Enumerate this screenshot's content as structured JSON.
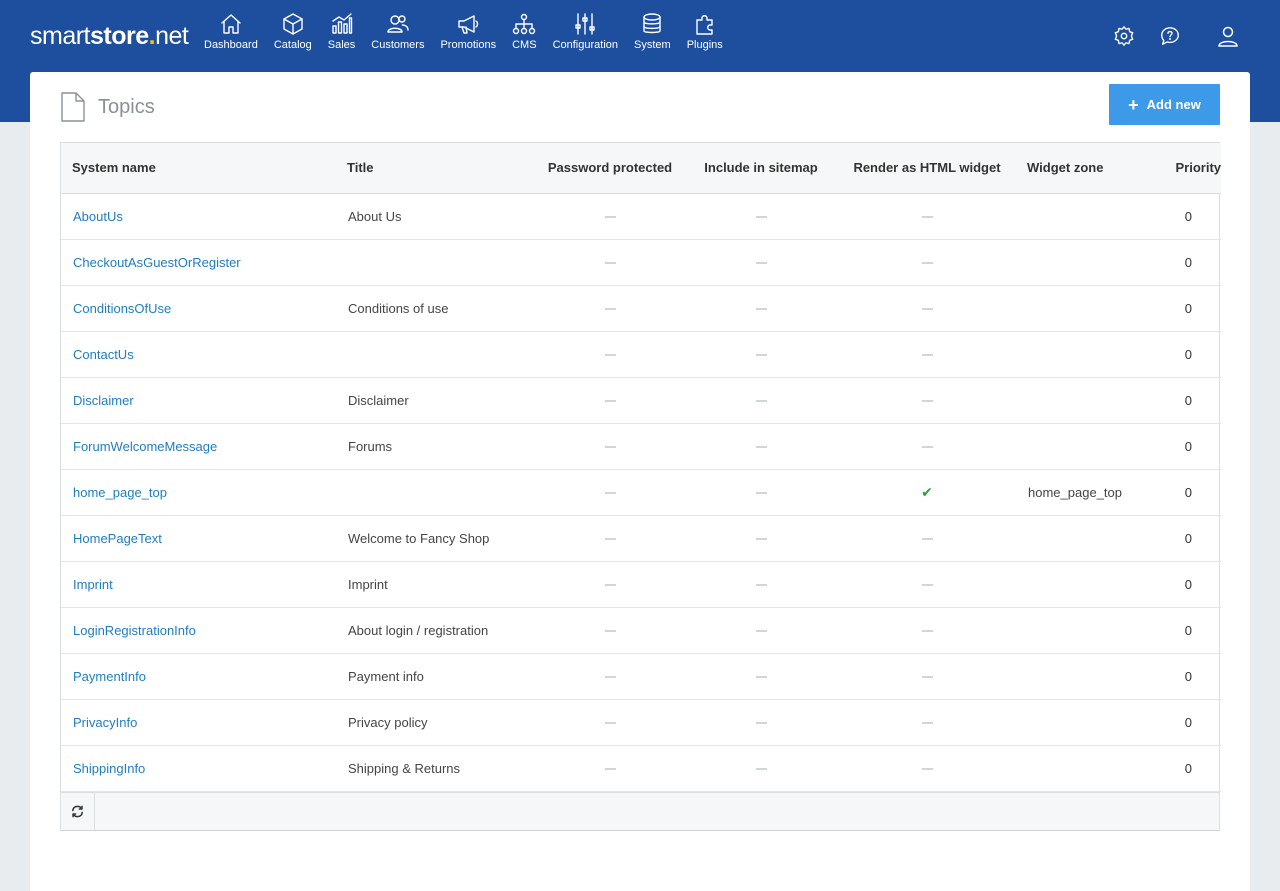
{
  "brand": {
    "part1": "smart",
    "part2": "store",
    "dot": ".",
    "part3": "net"
  },
  "nav": [
    {
      "label": "Dashboard",
      "icon": "house-icon"
    },
    {
      "label": "Catalog",
      "icon": "cube-icon"
    },
    {
      "label": "Sales",
      "icon": "bar-chart-icon"
    },
    {
      "label": "Customers",
      "icon": "users-icon"
    },
    {
      "label": "Promotions",
      "icon": "megaphone-icon"
    },
    {
      "label": "CMS",
      "icon": "sitemap-icon"
    },
    {
      "label": "Configuration",
      "icon": "sliders-icon"
    },
    {
      "label": "System",
      "icon": "database-icon"
    },
    {
      "label": "Plugins",
      "icon": "puzzle-icon"
    }
  ],
  "header_actions": {
    "settings": "gear-icon",
    "help": "help-chat-icon",
    "user": "user-icon"
  },
  "page": {
    "title": "Topics",
    "add_button": "Add new"
  },
  "grid": {
    "columns": [
      "System name",
      "Title",
      "Password protected",
      "Include in sitemap",
      "Render as HTML widget",
      "Widget zone",
      "Priority"
    ],
    "rows": [
      {
        "system_name": "AboutUs",
        "title": "About Us",
        "password_protected": false,
        "include_in_sitemap": false,
        "render_as_widget": false,
        "widget_zone": "",
        "priority": "0"
      },
      {
        "system_name": "CheckoutAsGuestOrRegister",
        "title": "",
        "password_protected": false,
        "include_in_sitemap": false,
        "render_as_widget": false,
        "widget_zone": "",
        "priority": "0"
      },
      {
        "system_name": "ConditionsOfUse",
        "title": "Conditions of use",
        "password_protected": false,
        "include_in_sitemap": false,
        "render_as_widget": false,
        "widget_zone": "",
        "priority": "0"
      },
      {
        "system_name": "ContactUs",
        "title": "",
        "password_protected": false,
        "include_in_sitemap": false,
        "render_as_widget": false,
        "widget_zone": "",
        "priority": "0"
      },
      {
        "system_name": "Disclaimer",
        "title": "Disclaimer",
        "password_protected": false,
        "include_in_sitemap": false,
        "render_as_widget": false,
        "widget_zone": "",
        "priority": "0"
      },
      {
        "system_name": "ForumWelcomeMessage",
        "title": "Forums",
        "password_protected": false,
        "include_in_sitemap": false,
        "render_as_widget": false,
        "widget_zone": "",
        "priority": "0"
      },
      {
        "system_name": "home_page_top",
        "title": "",
        "password_protected": false,
        "include_in_sitemap": false,
        "render_as_widget": true,
        "widget_zone": "home_page_top",
        "priority": "0"
      },
      {
        "system_name": "HomePageText",
        "title": "Welcome to Fancy Shop",
        "password_protected": false,
        "include_in_sitemap": false,
        "render_as_widget": false,
        "widget_zone": "",
        "priority": "0"
      },
      {
        "system_name": "Imprint",
        "title": "Imprint",
        "password_protected": false,
        "include_in_sitemap": false,
        "render_as_widget": false,
        "widget_zone": "",
        "priority": "0"
      },
      {
        "system_name": "LoginRegistrationInfo",
        "title": "About login / registration",
        "password_protected": false,
        "include_in_sitemap": false,
        "render_as_widget": false,
        "widget_zone": "",
        "priority": "0"
      },
      {
        "system_name": "PaymentInfo",
        "title": "Payment info",
        "password_protected": false,
        "include_in_sitemap": false,
        "render_as_widget": false,
        "widget_zone": "",
        "priority": "0"
      },
      {
        "system_name": "PrivacyInfo",
        "title": "Privacy policy",
        "password_protected": false,
        "include_in_sitemap": false,
        "render_as_widget": false,
        "widget_zone": "",
        "priority": "0"
      },
      {
        "system_name": "ShippingInfo",
        "title": "Shipping & Returns",
        "password_protected": false,
        "include_in_sitemap": false,
        "render_as_widget": false,
        "widget_zone": "",
        "priority": "0"
      }
    ]
  },
  "colors": {
    "header": "#1d4f9e",
    "accent_button": "#3c9ae8",
    "link": "#1f7ec0",
    "check": "#2ea043"
  }
}
